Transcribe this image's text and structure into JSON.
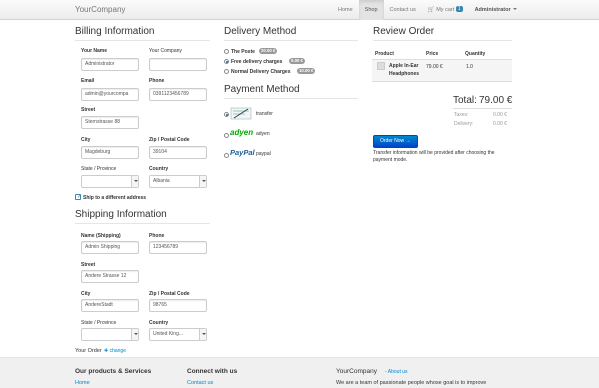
{
  "navbar": {
    "brand": "YourCompany",
    "home": "Home",
    "shop": "Shop",
    "contact": "Contact us",
    "cart_label": "My cart",
    "cart_count": "1",
    "user": "Administrator"
  },
  "billing": {
    "title": "Billing Information",
    "name_label": "Your Name",
    "name_value": "Administrator",
    "company_label": "Your Company",
    "company_value": "",
    "email_label": "Email",
    "email_value": "admin@yourcompa",
    "phone_label": "Phone",
    "phone_value": "0391123456789",
    "street_label": "Street",
    "street_value": "Sternstrasse 88",
    "city_label": "City",
    "city_value": "Magdeburg",
    "zip_label": "Zip / Postal Code",
    "zip_value": "39104",
    "state_label": "State / Province",
    "state_value": "",
    "country_label": "Country",
    "country_value": "Albania",
    "ship_diff_label": "Ship to a different address"
  },
  "shipping": {
    "title": "Shipping Information",
    "name_label": "Name (Shipping)",
    "name_value": "Admin Shipping",
    "phone_label": "Phone",
    "phone_value": "123456789",
    "street_label": "Street",
    "street_value": "Andere Strasse 12",
    "city_label": "City",
    "city_value": "AndereStadt",
    "zip_label": "Zip / Postal Code",
    "zip_value": "98765",
    "state_label": "State / Province",
    "state_value": "",
    "country_label": "Country",
    "country_value": "United King..."
  },
  "your_order": {
    "label": "Your Order",
    "change": "change"
  },
  "delivery": {
    "title": "Delivery Method",
    "options": [
      {
        "label": "The Poste",
        "price": "20.00 €",
        "selected": false
      },
      {
        "label": "Free delivery charges",
        "price": "0.00 €",
        "selected": true
      },
      {
        "label": "Normal Delivery Charges",
        "price": "10.00 €",
        "selected": false
      }
    ]
  },
  "payment": {
    "title": "Payment Method",
    "options": [
      {
        "label": "transfer",
        "logo": "wire-transfer",
        "selected": true
      },
      {
        "label": "adyen",
        "logo": "adyen",
        "selected": false
      },
      {
        "label": "paypal",
        "logo": "PayPal",
        "selected": false
      }
    ]
  },
  "review": {
    "title": "Review Order",
    "col_product": "Product",
    "col_price": "Price",
    "col_quantity": "Quantity",
    "item_name_line1": "Apple In-Ear",
    "item_name_line2": "Headphones",
    "item_price": "79.00 €",
    "item_qty": "1.0",
    "total_label": "Total:",
    "total_value": "79.00 €",
    "taxes_label": "Taxes:",
    "taxes_value": "0.00 €",
    "delivery_label": "Delivery:",
    "delivery_value": "0.00 €",
    "order_button": "Order Now →",
    "info_line1": "Transfer information will be provided after choosing the",
    "info_line2": "payment mode."
  },
  "footer": {
    "products_title": "Our products & Services",
    "products_link": "Home",
    "connect_title": "Connect with us",
    "connect_link": "Contact us",
    "company_title": "YourCompany",
    "company_about": "- About us",
    "company_text": "We are a team of passionate people whose goal is to improve"
  },
  "colors": {
    "accent": "#0088cc",
    "badge": "#999999"
  }
}
